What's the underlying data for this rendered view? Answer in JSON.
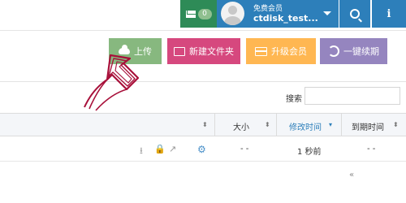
{
  "topbar": {
    "message_count": "0",
    "user_tier": "免费会员",
    "user_name": "ctdisk_test..."
  },
  "actions": {
    "upload": "上传",
    "new_folder": "新建文件夹",
    "upgrade": "升级会员",
    "renew": "一键续期"
  },
  "search": {
    "label": "搜索",
    "value": ""
  },
  "table": {
    "columns": {
      "size": "大小",
      "modified": "修改时间",
      "expires": "到期时间"
    },
    "rows": [
      {
        "size": "- -",
        "modified": "1 秒前",
        "expires": "- -"
      }
    ]
  },
  "pager": {
    "prev": "«"
  },
  "colors": {
    "message_green": "#2e8b57",
    "header_blue": "#2d7fba",
    "upload_green": "#87b87f",
    "newfolder_pink": "#d6487e",
    "upgrade_orange": "#ffb752",
    "renew_purple": "#9585bf",
    "arrow_red": "#a8103a"
  }
}
